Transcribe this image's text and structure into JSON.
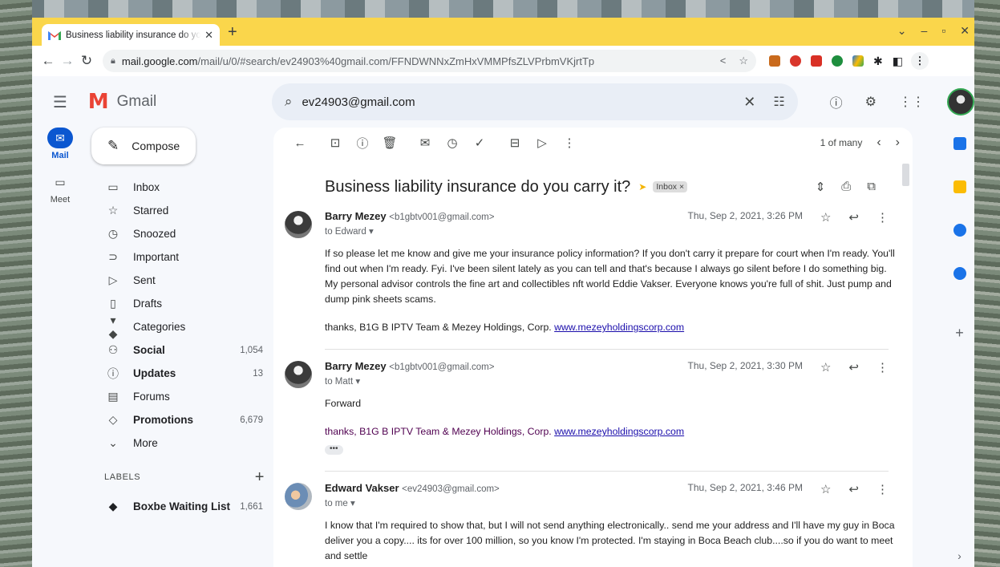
{
  "browser": {
    "tab_title": "Business liability insurance do yo",
    "url_host": "mail.google.com",
    "url_path": "/mail/u/0/#search/ev24903%40gmail.com/FFNDWNNxZmHxVMMPfsZLVPrbmVKjrtTp",
    "extensions": [
      "#c96a1c",
      "#d9362b",
      "#d93025",
      "#1e8e3e",
      "#1a73e8",
      "#202124"
    ]
  },
  "gmail": {
    "app_name": "Gmail",
    "search_query": "ev24903@gmail.com",
    "rail": [
      {
        "label": "Mail",
        "icon": "mail-icon",
        "active": true
      },
      {
        "label": "Meet",
        "icon": "video-icon",
        "active": false
      }
    ],
    "compose_label": "Compose",
    "nav": [
      {
        "label": "Inbox",
        "icon": "inbox-icon",
        "glyph": "▭",
        "count": "",
        "bold": false
      },
      {
        "label": "Starred",
        "icon": "star-icon",
        "glyph": "☆",
        "count": "",
        "bold": false
      },
      {
        "label": "Snoozed",
        "icon": "clock-icon",
        "glyph": "◷",
        "count": "",
        "bold": false
      },
      {
        "label": "Important",
        "icon": "important-icon",
        "glyph": "⊃",
        "count": "",
        "bold": false
      },
      {
        "label": "Sent",
        "icon": "send-icon",
        "glyph": "▷",
        "count": "",
        "bold": false
      },
      {
        "label": "Drafts",
        "icon": "draft-icon",
        "glyph": "▯",
        "count": "",
        "bold": false
      },
      {
        "label": "Categories",
        "icon": "label-icon",
        "glyph": "▾ ◆",
        "count": "",
        "bold": false
      },
      {
        "label": "Social",
        "icon": "people-icon",
        "glyph": "⚇",
        "count": "1,054",
        "bold": true
      },
      {
        "label": "Updates",
        "icon": "info-icon",
        "glyph": "ⓘ",
        "count": "13",
        "bold": true
      },
      {
        "label": "Forums",
        "icon": "forum-icon",
        "glyph": "▤",
        "count": "",
        "bold": false
      },
      {
        "label": "Promotions",
        "icon": "tag-icon",
        "glyph": "◇",
        "count": "6,679",
        "bold": true
      },
      {
        "label": "More",
        "icon": "chevron-down-icon",
        "glyph": "⌄",
        "count": "",
        "bold": false
      }
    ],
    "labels_heading": "LABELS",
    "label_items": [
      {
        "label": "Boxbe Waiting List",
        "count": "1,661"
      }
    ],
    "pager": "1 of many",
    "thread": {
      "subject": "Business liability insurance do you carry it?",
      "chip": "Inbox ×",
      "messages": [
        {
          "name": "Barry Mezey",
          "email": "<b1gbtv001@gmail.com>",
          "to": "to Edward ▾",
          "date": "Thu, Sep 2, 2021, 3:26 PM",
          "body": "If so please let me know and give me your insurance policy information? If you don't carry it prepare for court when I'm ready. You'll find out when I'm ready. Fyi. I've been silent lately as you can tell and that's because I always go silent before I do something big. My personal advisor controls the fine art and collectibles nft world Eddie Vakser. Everyone knows you're full of shit. Just pump and dump pink sheets scams.",
          "sig": "thanks, B1G B IPTV Team & Mezey Holdings, Corp.",
          "link": "www.mezeyholdingscorp.com"
        },
        {
          "name": "Barry Mezey",
          "email": "<b1gbtv001@gmail.com>",
          "to": "to Matt ▾",
          "date": "Thu, Sep 2, 2021, 3:30 PM",
          "body": "Forward",
          "sig": "thanks, B1G B IPTV Team & Mezey Holdings, Corp.",
          "link": "www.mezeyholdingscorp.com",
          "ellipsis": "•••"
        },
        {
          "name": "Edward Vakser",
          "email": "<ev24903@gmail.com>",
          "to": "to me ▾",
          "date": "Thu, Sep 2, 2021, 3:46 PM",
          "body": "I know that I'm required to show that, but I will not send anything electronically.. send me your address and I'll have my guy in Boca deliver you a copy.... its for over 100 million, so you know I'm protected. I'm staying in Boca Beach club....so if you do want to meet and settle"
        }
      ]
    },
    "side_panel_colors": [
      "#1a73e8",
      "#fbbc04",
      "#1a73e8",
      "#1a73e8"
    ]
  }
}
